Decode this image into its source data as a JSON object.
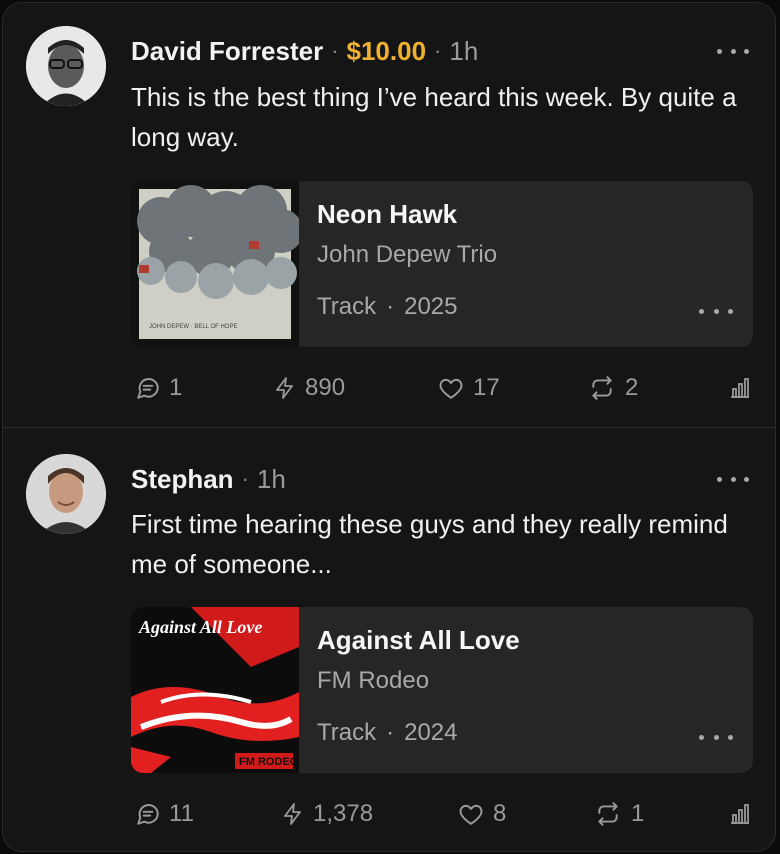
{
  "posts": [
    {
      "author": "David Forrester",
      "amount": "$10.00",
      "time": "1h",
      "text": "This is the best thing I’ve heard this week. By quite a long way.",
      "card": {
        "title": "Neon Hawk",
        "artist": "John Depew Trio",
        "type": "Track",
        "year": "2025",
        "cover_text": "JOHN DEPEW · BELL OF HOPE"
      },
      "stats": {
        "comments": "1",
        "zaps": "890",
        "likes": "17",
        "reposts": "2"
      }
    },
    {
      "author": "Stephan",
      "time": "1h",
      "text": "First time hearing these guys and they really remind me of someone...",
      "card": {
        "title": "Against All Love",
        "artist": "FM Rodeo",
        "type": "Track",
        "year": "2024",
        "cover_title": "Against All Love",
        "cover_badge": "FM RODEO"
      },
      "stats": {
        "comments": "11",
        "zaps": "1,378",
        "likes": "8",
        "reposts": "1"
      }
    }
  ],
  "colors": {
    "background": "#151515",
    "card": "#262626",
    "accent": "#f0b22e",
    "muted": "#9a9a9a"
  },
  "icons": [
    "comment-icon",
    "zap-icon",
    "heart-icon",
    "repost-icon",
    "stats-icon",
    "more-icon"
  ]
}
